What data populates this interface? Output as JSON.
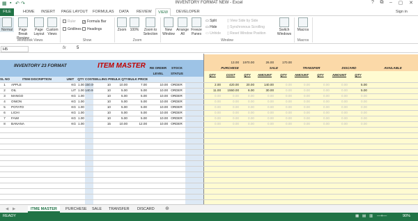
{
  "window": {
    "title": "INVENTORY FORMAT NEW - Excel",
    "sign_in": "Sign in",
    "min": "–",
    "max": "▢",
    "close": "✕",
    "help": "?",
    "restore": "⧉"
  },
  "tabs": [
    "FILE",
    "HOME",
    "INSERT",
    "PAGE LAYOUT",
    "FORMULAS",
    "DATA",
    "REVIEW",
    "VIEW",
    "DEVELOPER"
  ],
  "ribbon": {
    "normal": "Normal",
    "page_break": "Page Break Preview",
    "page_layout": "Page Layout",
    "custom_views": "Custom Views",
    "ruler": "Ruler",
    "gridlines": "Gridlines",
    "formula_bar": "Formula Bar",
    "headings": "Headings",
    "zoom": "Zoom",
    "zoom100": "100%",
    "zoom_sel": "Zoom to Selection",
    "new_window": "New Window",
    "arrange_all": "Arrange All",
    "freeze": "Freeze Panes",
    "split": "Split",
    "hide": "Hide",
    "unhide": "Unhide",
    "side_by_side": "View Side by Side",
    "sync_scroll": "Synchronous Scrolling",
    "reset_pos": "Reset Window Position",
    "switch_windows": "Switch Windows",
    "macros": "Macros",
    "groups": {
      "workbook_views": "Workbook Views",
      "show": "Show",
      "zoom": "Zoom",
      "window": "Window",
      "macros": "Macros"
    }
  },
  "formula_bar": {
    "name_box": "H5",
    "fx": "fx",
    "value": "5"
  },
  "sheet": {
    "inventory_title": "INVENTORY 23 FORMAT",
    "item_master": "ITEM MASTER",
    "headers": [
      "SL NO",
      "ITEM DISCRIPTION",
      "UNIT",
      "QTY",
      "COST",
      "SELLING PRICE",
      "BULK QTY",
      "BULK PRICE",
      "RE ORDER LEVEL",
      "STOCK STATUS"
    ],
    "rows": [
      [
        "1",
        "APPLE",
        "KG",
        "1.00",
        "150.00",
        "10",
        "10.00",
        "7.00",
        "10.00",
        "ORDER"
      ],
      [
        "2",
        "OIL",
        "LIT",
        "1.00",
        "140.91",
        "10",
        "5.00",
        "5.00",
        "10.00",
        "ORDER"
      ],
      [
        "3",
        "MANGO",
        "KG",
        "1.00",
        "",
        "10",
        "5.00",
        "5.00",
        "10.00",
        "ORDER"
      ],
      [
        "4",
        "ONION",
        "KG",
        "1.00",
        "",
        "10",
        "5.00",
        "5.00",
        "10.00",
        "ORDER"
      ],
      [
        "5",
        "POTATO",
        "KG",
        "1.00",
        "",
        "10",
        "5.00",
        "5.00",
        "10.00",
        "ORDER"
      ],
      [
        "6",
        "LICHI",
        "KG",
        "1.00",
        "",
        "10",
        "5.00",
        "5.00",
        "10.00",
        "ORDER"
      ],
      [
        "7",
        "FAWI",
        "KG",
        "1.00",
        "",
        "10",
        "5.00",
        "5.00",
        "10.00",
        "ORDER"
      ],
      [
        "8",
        "BANANA",
        "KG",
        "1.00",
        "",
        "15",
        "10.00",
        "12.00",
        "10.00",
        "ORDER"
      ]
    ],
    "totals": [
      "13.00",
      "1970.00",
      "26.00",
      "170.00"
    ],
    "sections": [
      "PURCHESE",
      "SALE",
      "TRANSFER",
      "DISCARD",
      "AVAILABLE"
    ],
    "sub_headers": [
      "QTY",
      "COST",
      "QTY",
      "AMOUNT",
      "QTY",
      "AMOUNT",
      "QTY",
      "AMOUNT",
      "QTY"
    ],
    "purchase_rows": [
      [
        "2.00",
        "420.00",
        "20.00",
        "140.00",
        "",
        "",
        "",
        "",
        "5.00"
      ],
      [
        "11.00",
        "1550.00",
        "6.00",
        "30.00",
        "",
        "",
        "",
        "",
        "5.00"
      ]
    ],
    "zero": "0.00"
  },
  "sheet_tabs": [
    "ITME MASTER",
    "PURCHESE",
    "SALE",
    "TRANSFER",
    "DISCARD"
  ],
  "status": {
    "ready": "READY",
    "zoom": "90%"
  }
}
